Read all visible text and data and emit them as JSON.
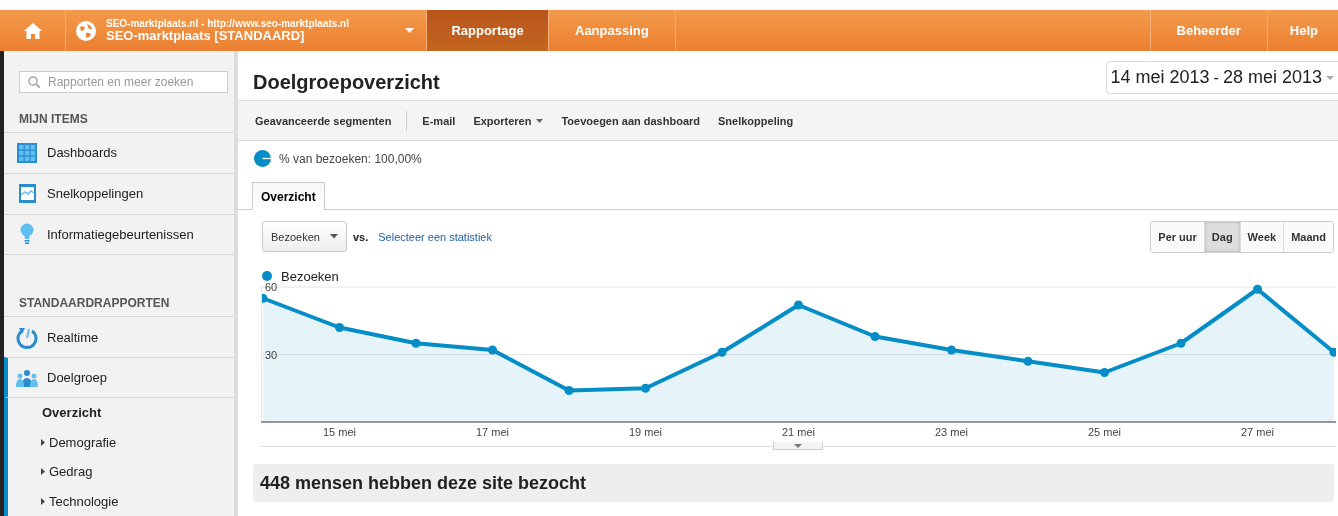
{
  "header": {
    "property_url": "SEO-marktplaats.nl - http://www.seo-marktplaats.nl",
    "property_name": "SEO-marktplaats [STANDAARD]",
    "tabs": [
      {
        "label": "Rapportage",
        "selected": true
      },
      {
        "label": "Aanpassing",
        "selected": false
      }
    ],
    "right_tabs": [
      {
        "label": "Beheerder",
        "selected": false
      },
      {
        "label": "Help",
        "selected": false
      }
    ]
  },
  "sidebar": {
    "search": {
      "placeholder": "Rapporten en meer zoeken"
    },
    "sections": [
      {
        "title": "MIJN ITEMS",
        "items": [
          {
            "label": "Dashboards",
            "kind": "grid",
            "selected": false
          },
          {
            "label": "Snelkoppelingen",
            "kind": "shortcut",
            "selected": false
          },
          {
            "label": "Informatiegebeurtenissen",
            "kind": "bulb",
            "selected": false
          }
        ]
      },
      {
        "title": "STANDAARDRAPPORTEN",
        "items": [
          {
            "label": "Realtime",
            "kind": "clock",
            "selected": false
          },
          {
            "label": "Doelgroep",
            "kind": "people",
            "selected": true,
            "expanded": true,
            "children": [
              {
                "label": "Overzicht",
                "selected": true,
                "expandable": false
              },
              {
                "label": "Demografie",
                "selected": false,
                "expandable": true
              },
              {
                "label": "Gedrag",
                "selected": false,
                "expandable": true
              },
              {
                "label": "Technologie",
                "selected": false,
                "expandable": true
              }
            ]
          }
        ]
      }
    ]
  },
  "main": {
    "title": "Doelgroepoverzicht",
    "date_start": "14 mei 2013",
    "date_separator": "-",
    "date_end": "28 mei 2013",
    "toolbar": [
      {
        "label": "Geavanceerde segmenten",
        "has_menu": false
      },
      {
        "label": "E-mail",
        "has_menu": false
      },
      {
        "label": "Exporteren",
        "has_menu": true
      },
      {
        "label": "Toevoegen aan dashboard",
        "has_menu": false
      },
      {
        "label": "Snelkoppeling",
        "has_menu": false
      }
    ],
    "segment": "% van bezoeken: 100,00%",
    "tabs": [
      {
        "label": "Overzicht",
        "selected": true
      }
    ],
    "metric": "Bezoeken",
    "vs": "vs.",
    "compare_link": "Selecteer een statistiek",
    "granularity": [
      {
        "label": "Per uur",
        "selected": false
      },
      {
        "label": "Dag",
        "selected": true
      },
      {
        "label": "Week",
        "selected": false
      },
      {
        "label": "Maand",
        "selected": false
      }
    ],
    "chart_data": {
      "type": "area",
      "x": [
        14,
        15,
        16,
        17,
        18,
        19,
        20,
        21,
        22,
        23,
        24,
        25,
        26,
        27,
        28
      ],
      "series": [
        {
          "name": "Bezoeken",
          "color": "#058dc7",
          "values": [
            55,
            42,
            35,
            32,
            14,
            15,
            31,
            52,
            38,
            32,
            27,
            22,
            35,
            59,
            31
          ]
        }
      ],
      "xlim": [
        14,
        28
      ],
      "ylim": [
        0,
        60
      ],
      "yticks": [
        30,
        60
      ],
      "xticks": [
        {
          "value": 15,
          "label": "15 mei"
        },
        {
          "value": 17,
          "label": "17 mei"
        },
        {
          "value": 19,
          "label": "19 mei"
        },
        {
          "value": 21,
          "label": "21 mei"
        },
        {
          "value": 23,
          "label": "23 mei"
        },
        {
          "value": 25,
          "label": "25 mei"
        },
        {
          "value": 27,
          "label": "27 mei"
        }
      ]
    },
    "summary": "448 mensen hebben deze site bezocht"
  }
}
